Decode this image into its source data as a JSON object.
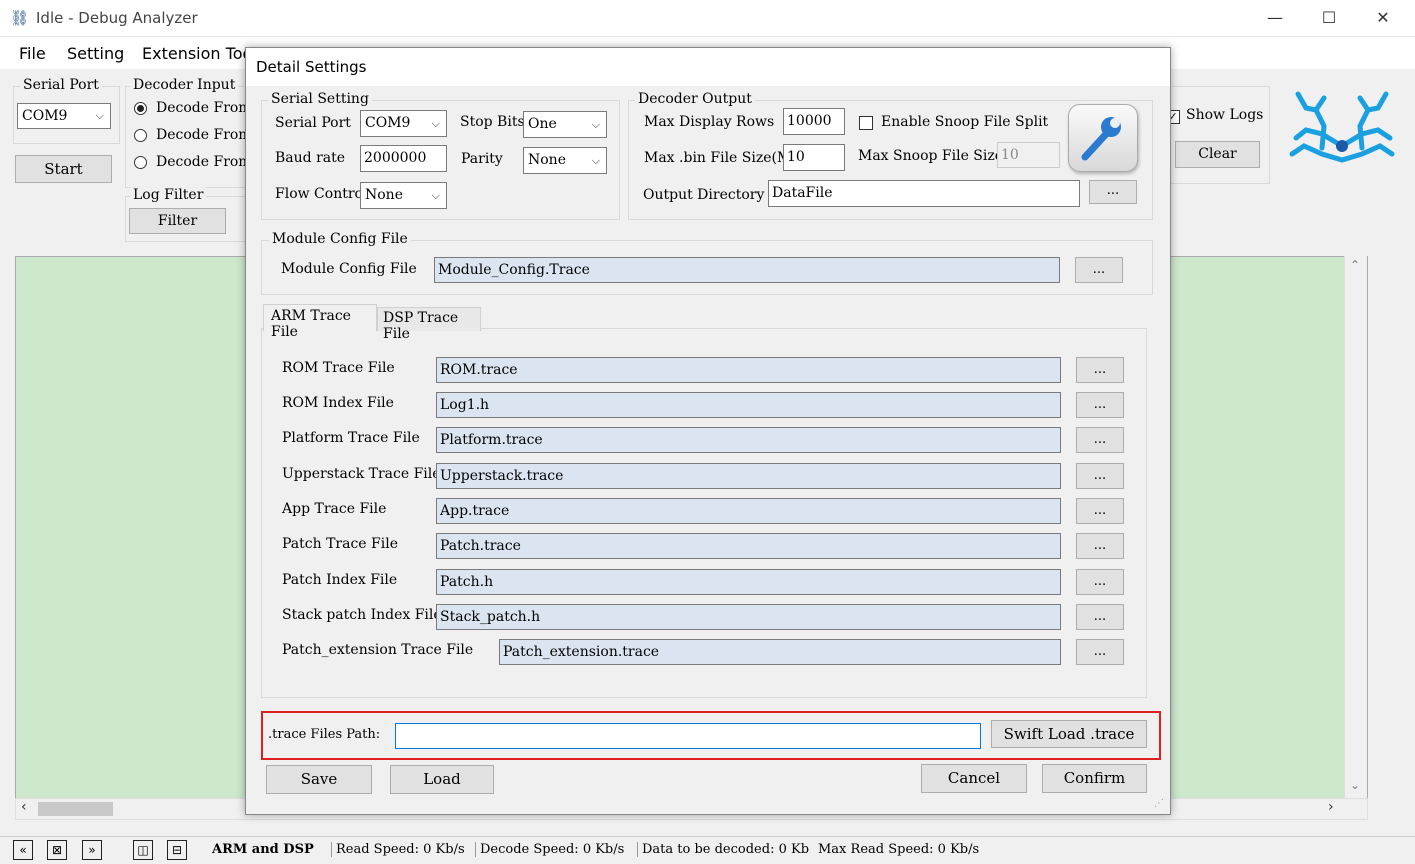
{
  "app": {
    "title": "Idle - Debug Analyzer",
    "window_controls": {
      "minimize": "—",
      "maximize": "☐",
      "close": "✕"
    },
    "menu": [
      "File",
      "Setting",
      "Extension Too"
    ]
  },
  "main": {
    "serial_port": {
      "label": "Serial Port",
      "value": "COM9"
    },
    "start_button": "Start",
    "decoder_input": {
      "label": "Decoder Input",
      "options": [
        "Decode From",
        "Decode From",
        "Decode From"
      ],
      "selected_index": 0
    },
    "log_filter": {
      "label": "Log Filter",
      "filter_button": "Filter"
    },
    "show_logs": {
      "label": "Show Logs",
      "checked": true
    },
    "clear_button": "Clear",
    "log_area_color": "#cde8cd"
  },
  "dialog": {
    "title": "Detail Settings",
    "serial_setting": {
      "label": "Serial Setting",
      "serial_port": {
        "label": "Serial Port",
        "value": "COM9"
      },
      "stop_bits": {
        "label": "Stop Bits",
        "value": "One"
      },
      "baud_rate": {
        "label": "Baud rate",
        "value": "2000000"
      },
      "parity": {
        "label": "Parity",
        "value": "None"
      },
      "flow_control": {
        "label": "Flow Control",
        "value": "None"
      }
    },
    "decoder_output": {
      "label": "Decoder Output",
      "max_display_rows": {
        "label": "Max Display Rows",
        "value": "10000"
      },
      "enable_snoop": {
        "label": "Enable Snoop File Split",
        "checked": false
      },
      "max_bin_size": {
        "label": "Max .bin File Size(M)",
        "value": "10"
      },
      "max_snoop_size": {
        "label": "Max Snoop File Size",
        "value": "10"
      },
      "output_directory": {
        "label": "Output Directory",
        "value": "DataFile"
      },
      "browse": "..."
    },
    "module_config": {
      "group_label": "Module Config File",
      "label": "Module Config File",
      "value": "Module_Config.Trace",
      "browse": "..."
    },
    "tabs": [
      {
        "label": "ARM Trace File",
        "active": true
      },
      {
        "label": "DSP Trace File",
        "active": false
      }
    ],
    "trace_files": [
      {
        "label": "ROM Trace File",
        "value": "ROM.trace"
      },
      {
        "label": "ROM Index File",
        "value": "Log1.h"
      },
      {
        "label": "Platform Trace File",
        "value": "Platform.trace"
      },
      {
        "label": "Upperstack Trace File",
        "value": "Upperstack.trace"
      },
      {
        "label": "App Trace File",
        "value": "App.trace"
      },
      {
        "label": "Patch Trace File",
        "value": "Patch.trace"
      },
      {
        "label": "Patch Index File",
        "value": "Patch.h"
      },
      {
        "label": "Stack patch Index File",
        "value": "Stack_patch.h"
      },
      {
        "label": "Patch_extension Trace File",
        "value": "Patch_extension.trace"
      }
    ],
    "browse_label": "...",
    "trace_path": {
      "label": ".trace Files Path:",
      "value": "",
      "highlight_color": "#e02020"
    },
    "swift_load_button": "Swift Load .trace",
    "save_button": "Save",
    "load_button": "Load",
    "cancel_button": "Cancel",
    "confirm_button": "Confirm"
  },
  "status": {
    "mode": "ARM and DSP",
    "read_speed": "Read Speed:  0 Kb/s",
    "decode_speed": "Decode Speed:  0 Kb/s",
    "data_to_decode": "Data to be decoded:  0 Kb",
    "max_read_speed": "Max Read Speed:  0 Kb/s"
  }
}
